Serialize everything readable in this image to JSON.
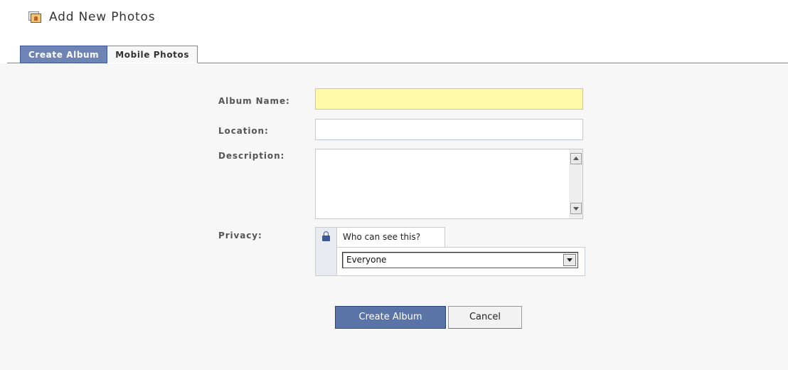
{
  "header": {
    "icon": "photos-icon",
    "title": "Add New Photos"
  },
  "tabs": [
    {
      "label": "Create Album",
      "active": true
    },
    {
      "label": "Mobile Photos",
      "active": false
    }
  ],
  "form": {
    "album_name": {
      "label": "Album Name:",
      "value": ""
    },
    "location": {
      "label": "Location:",
      "value": ""
    },
    "description": {
      "label": "Description:",
      "value": ""
    },
    "privacy": {
      "label": "Privacy:",
      "tab_label": "Who can see this?",
      "lock_icon": "lock-icon",
      "selected": "Everyone"
    }
  },
  "buttons": {
    "create": "Create Album",
    "cancel": "Cancel"
  },
  "colors": {
    "accent": "#6d84b4",
    "primary_button": "#5b74a8",
    "focused_input": "#fff9a9",
    "panel": "#f7f7f7"
  }
}
